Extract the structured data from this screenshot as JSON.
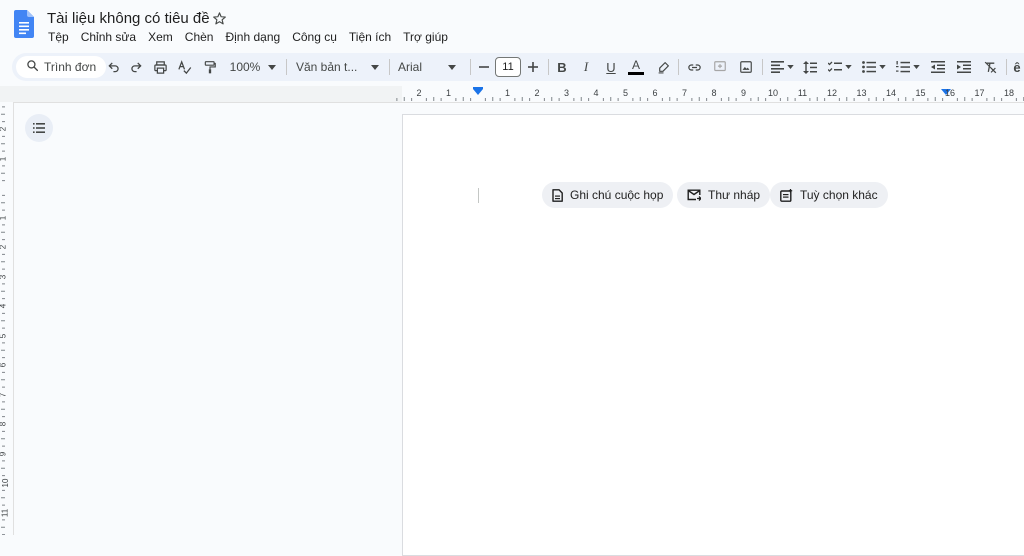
{
  "header": {
    "title": "Tài liệu không có tiêu đề",
    "menus": [
      "Tệp",
      "Chỉnh sửa",
      "Xem",
      "Chèn",
      "Định dạng",
      "Công cụ",
      "Tiện ích",
      "Trợ giúp"
    ]
  },
  "toolbar": {
    "search_placeholder": "Trình đơn",
    "zoom": "100%",
    "style": "Văn bản t...",
    "font": "Arial",
    "font_size": "11",
    "bold": "B",
    "italic": "I",
    "underline": "U",
    "text_color": "A"
  },
  "ruler": {
    "top_numbers": [
      "2",
      "1",
      "1",
      "2",
      "3",
      "4",
      "5",
      "6",
      "7",
      "8",
      "9",
      "10",
      "11",
      "12",
      "13",
      "14",
      "15",
      "16",
      "17",
      "18"
    ],
    "left_numbers": [
      "2",
      "1",
      "1",
      "2",
      "3",
      "4",
      "5",
      "6",
      "7",
      "8",
      "9",
      "10",
      "11"
    ]
  },
  "chips": [
    {
      "label": "Ghi chú cuộc họp",
      "icon": "document-icon"
    },
    {
      "label": "Thư nháp",
      "icon": "email-draft-icon"
    },
    {
      "label": "Tuỳ chọn khác",
      "icon": "more-options-icon"
    }
  ],
  "colors": {
    "accent": "#1a73e8",
    "toolbar_bg": "#edf2fa",
    "page_bg": "#ffffff",
    "chip_bg": "#eef0f4"
  }
}
